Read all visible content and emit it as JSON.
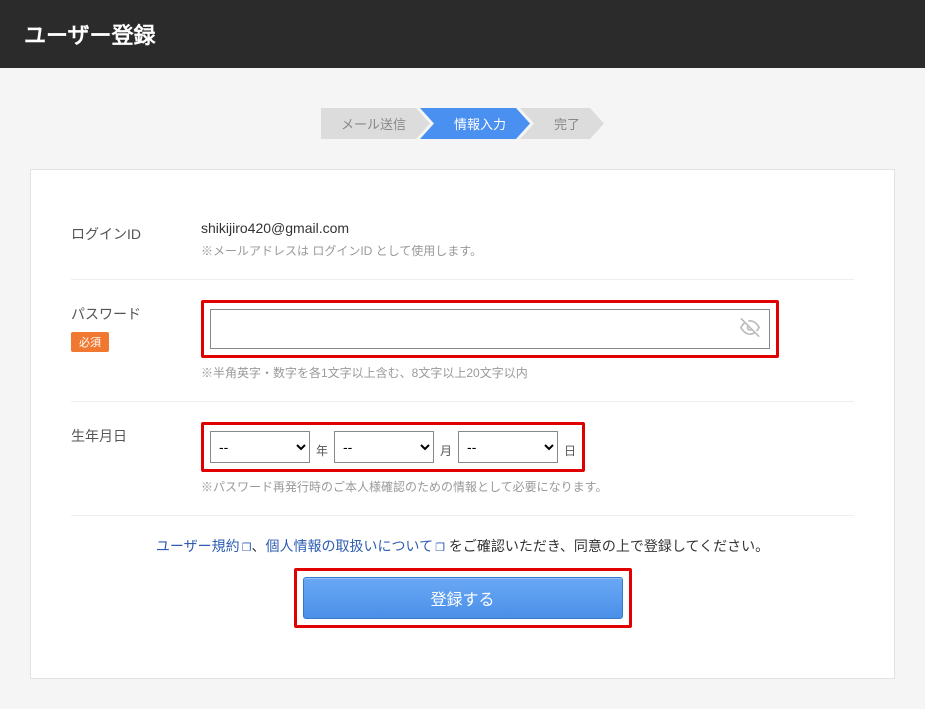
{
  "header": {
    "title": "ユーザー登録"
  },
  "steps": {
    "mail": "メール送信",
    "input": "情報入力",
    "done": "完了"
  },
  "form": {
    "login_id": {
      "label": "ログインID",
      "value": "shikijiro420@gmail.com",
      "hint": "※メールアドレスは ログインID として使用します。"
    },
    "password": {
      "label": "パスワード",
      "required_badge": "必須",
      "value": "",
      "hint": "※半角英字・数字を各1文字以上含む、8文字以上20文字以内"
    },
    "birthdate": {
      "label": "生年月日",
      "year": "--",
      "year_unit": "年",
      "month": "--",
      "month_unit": "月",
      "day": "--",
      "day_unit": "日",
      "hint": "※パスワード再発行時のご本人様確認のための情報として必要になります。"
    }
  },
  "agreement": {
    "terms_link": "ユーザー規約",
    "separator": "、",
    "privacy_link": "個人情報の取扱いについて",
    "tail": " をご確認いただき、同意の上で登録してください。"
  },
  "submit": {
    "label": "登録する"
  }
}
